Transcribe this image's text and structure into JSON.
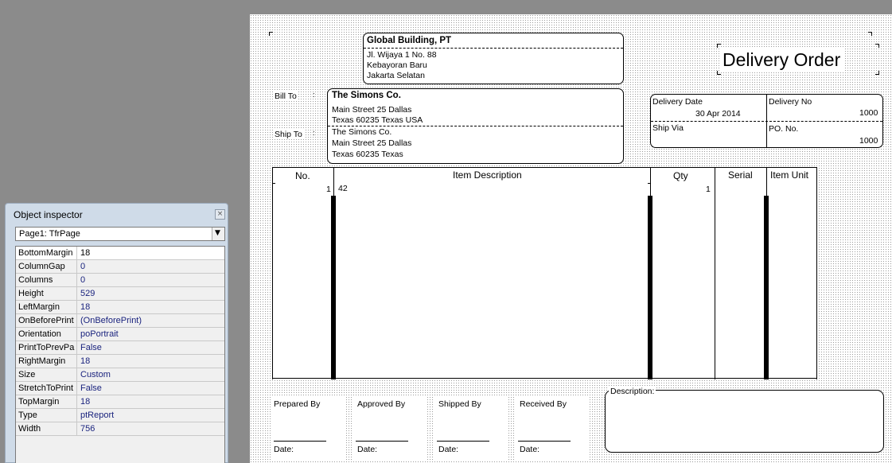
{
  "company": {
    "name": "Global Building, PT",
    "address1": "Jl. Wijaya 1 No. 88",
    "address2": "Kebayoran Baru",
    "address3": "Jakarta Selatan"
  },
  "report_title": "Delivery Order",
  "bill_to": {
    "label": "Bill To",
    "name": "The Simons Co.",
    "line1": "Main Street 25 Dallas",
    "line2": "Texas 60235 Texas USA"
  },
  "ship_to": {
    "label": "Ship To",
    "name": "The Simons Co.",
    "line1": "Main Street 25 Dallas",
    "line2": "Texas 60235  Texas"
  },
  "delivery": {
    "date_label": "Delivery Date",
    "date_value": "30 Apr 2014",
    "no_label": "Delivery No",
    "no_value": "1000",
    "ship_via_label": "Ship Via",
    "po_label": "PO. No.",
    "po_value": "1000"
  },
  "table": {
    "headers": [
      "No.",
      "Item Description",
      "Qty",
      "Serial",
      "Item Unit"
    ],
    "row": {
      "no": "1",
      "item": "42",
      "qty": "1"
    }
  },
  "signatures": {
    "prepared": "Prepared By",
    "approved": "Approved By",
    "shipped": "Shipped By",
    "received": "Received By",
    "date": "Date:"
  },
  "description_label": "Description:",
  "inspector": {
    "title": "Object inspector",
    "selected_object": "Page1: TfrPage",
    "close_glyph": "×",
    "dropdown_glyph": "▼",
    "properties": [
      {
        "name": "BottomMargin",
        "value": "18"
      },
      {
        "name": "ColumnGap",
        "value": "0"
      },
      {
        "name": "Columns",
        "value": "0"
      },
      {
        "name": "Height",
        "value": "529"
      },
      {
        "name": "LeftMargin",
        "value": "18"
      },
      {
        "name": "OnBeforePrint",
        "value": "(OnBeforePrint)"
      },
      {
        "name": "Orientation",
        "value": "poPortrait"
      },
      {
        "name": "PrintToPrevPa",
        "value": "False"
      },
      {
        "name": "RightMargin",
        "value": "18"
      },
      {
        "name": "Size",
        "value": "Custom"
      },
      {
        "name": "StretchToPrint",
        "value": "False"
      },
      {
        "name": "TopMargin",
        "value": "18"
      },
      {
        "name": "Type",
        "value": "ptReport"
      },
      {
        "name": "Width",
        "value": "756"
      }
    ]
  }
}
